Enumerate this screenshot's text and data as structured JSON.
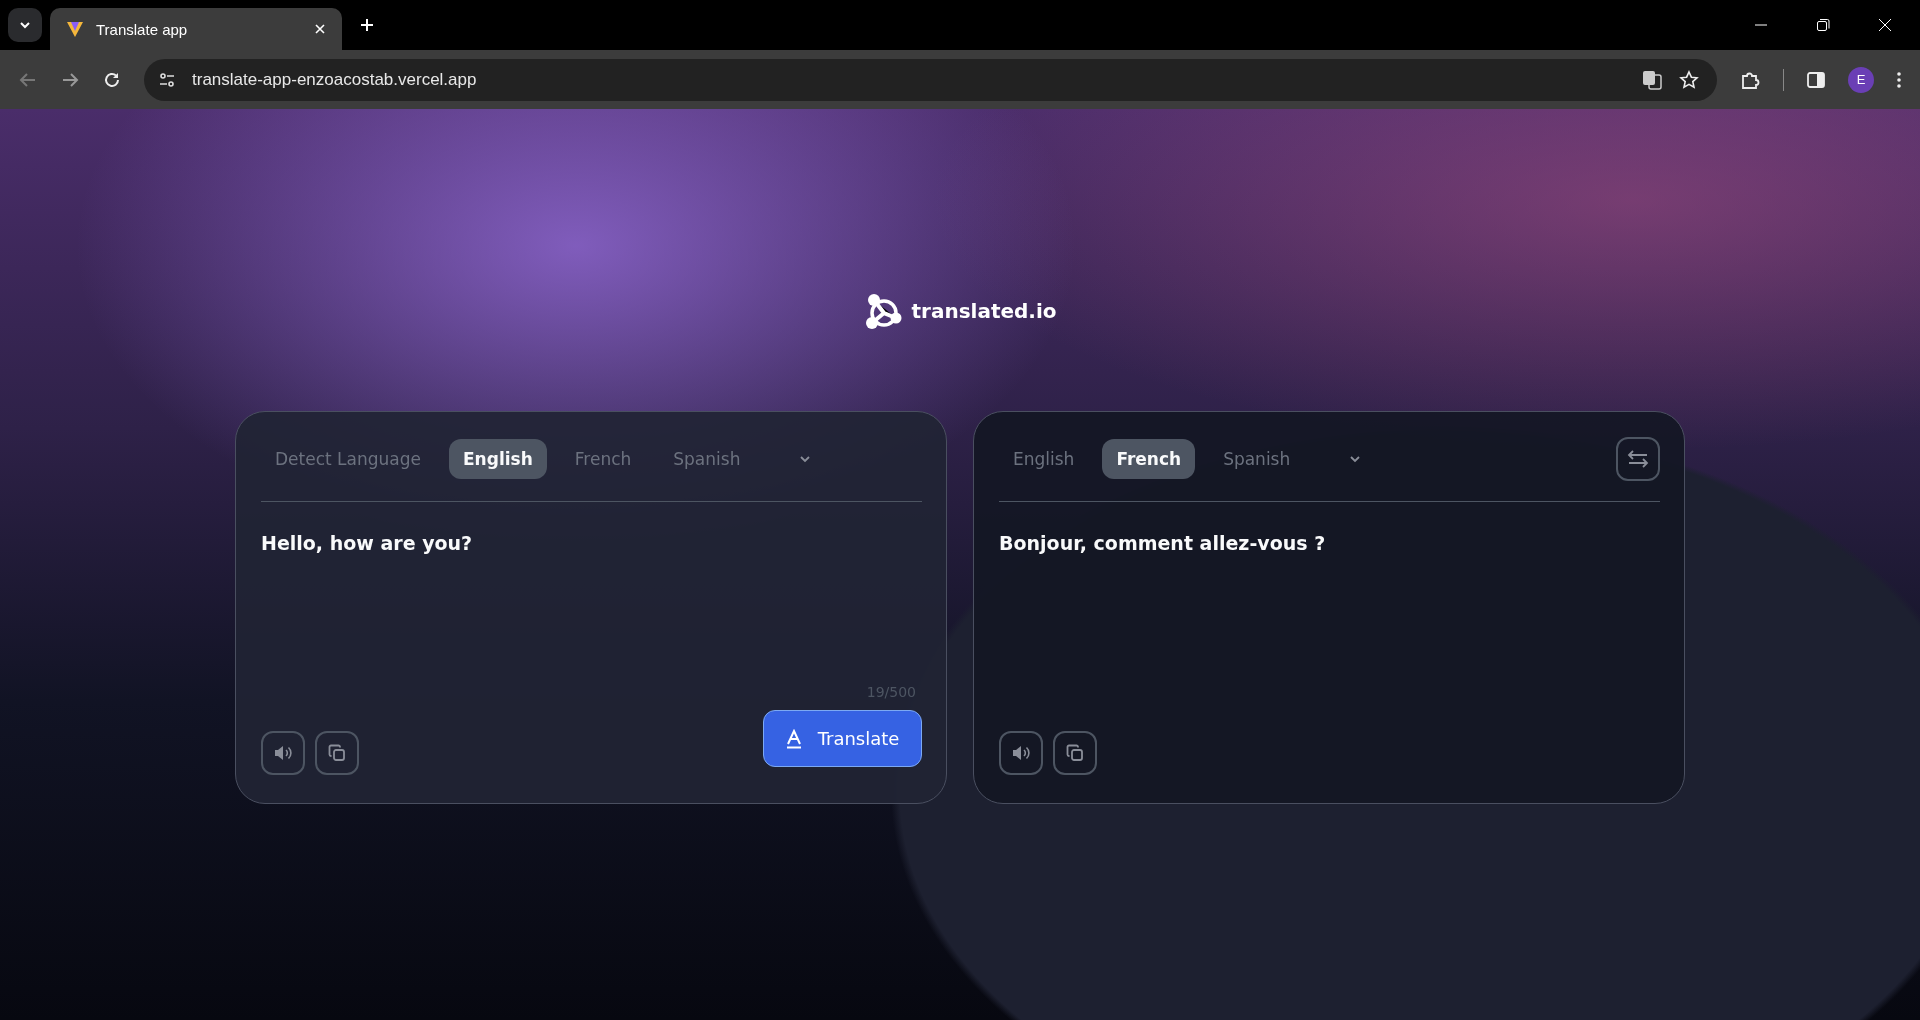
{
  "browser": {
    "tab_title": "Translate app",
    "url": "translate-app-enzoacostab.vercel.app",
    "profile_initial": "E"
  },
  "logo": {
    "text": "translated.io"
  },
  "source_panel": {
    "languages": [
      {
        "label": "Detect Language",
        "selected": false
      },
      {
        "label": "English",
        "selected": true
      },
      {
        "label": "French",
        "selected": false
      },
      {
        "label": "Spanish",
        "selected": false
      }
    ],
    "text": "Hello, how are you?",
    "char_count": "19/500",
    "translate_button": "Translate"
  },
  "target_panel": {
    "languages": [
      {
        "label": "English",
        "selected": false
      },
      {
        "label": "French",
        "selected": true
      },
      {
        "label": "Spanish",
        "selected": false
      }
    ],
    "text": "Bonjour, comment allez-vous ?"
  }
}
